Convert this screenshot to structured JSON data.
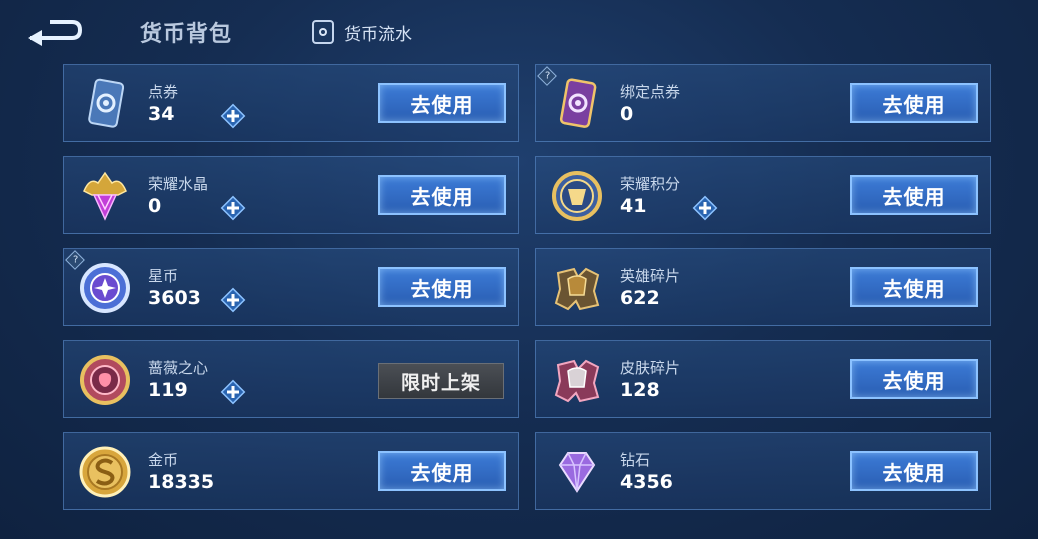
{
  "header": {
    "title": "货币背包",
    "flow_label": "货币流水"
  },
  "currencies": [
    {
      "name": "点券",
      "count": "34",
      "button": "去使用"
    },
    {
      "name": "绑定点券",
      "count": "0",
      "button": "去使用"
    },
    {
      "name": "荣耀水晶",
      "count": "0",
      "button": "去使用"
    },
    {
      "name": "荣耀积分",
      "count": "41",
      "button": "去使用"
    },
    {
      "name": "星币",
      "count": "3603",
      "button": "去使用"
    },
    {
      "name": "英雄碎片",
      "count": "622",
      "button": "去使用"
    },
    {
      "name": "蔷薇之心",
      "count": "119",
      "button": "限时上架"
    },
    {
      "name": "皮肤碎片",
      "count": "128",
      "button": "去使用"
    },
    {
      "name": "金币",
      "count": "18335",
      "button": "去使用"
    },
    {
      "name": "钻石",
      "count": "4356",
      "button": "去使用"
    }
  ],
  "icons": {
    "back": "back-arrow-icon",
    "flow": "currency-flow-icon",
    "plus": "plus-icon",
    "help": "help-question-icon"
  },
  "help_mark": "?",
  "colors": {
    "background": "#152d52",
    "card_border": "#6092d2",
    "use_button": "#2f68c2",
    "limited_button": "#3d4146"
  }
}
